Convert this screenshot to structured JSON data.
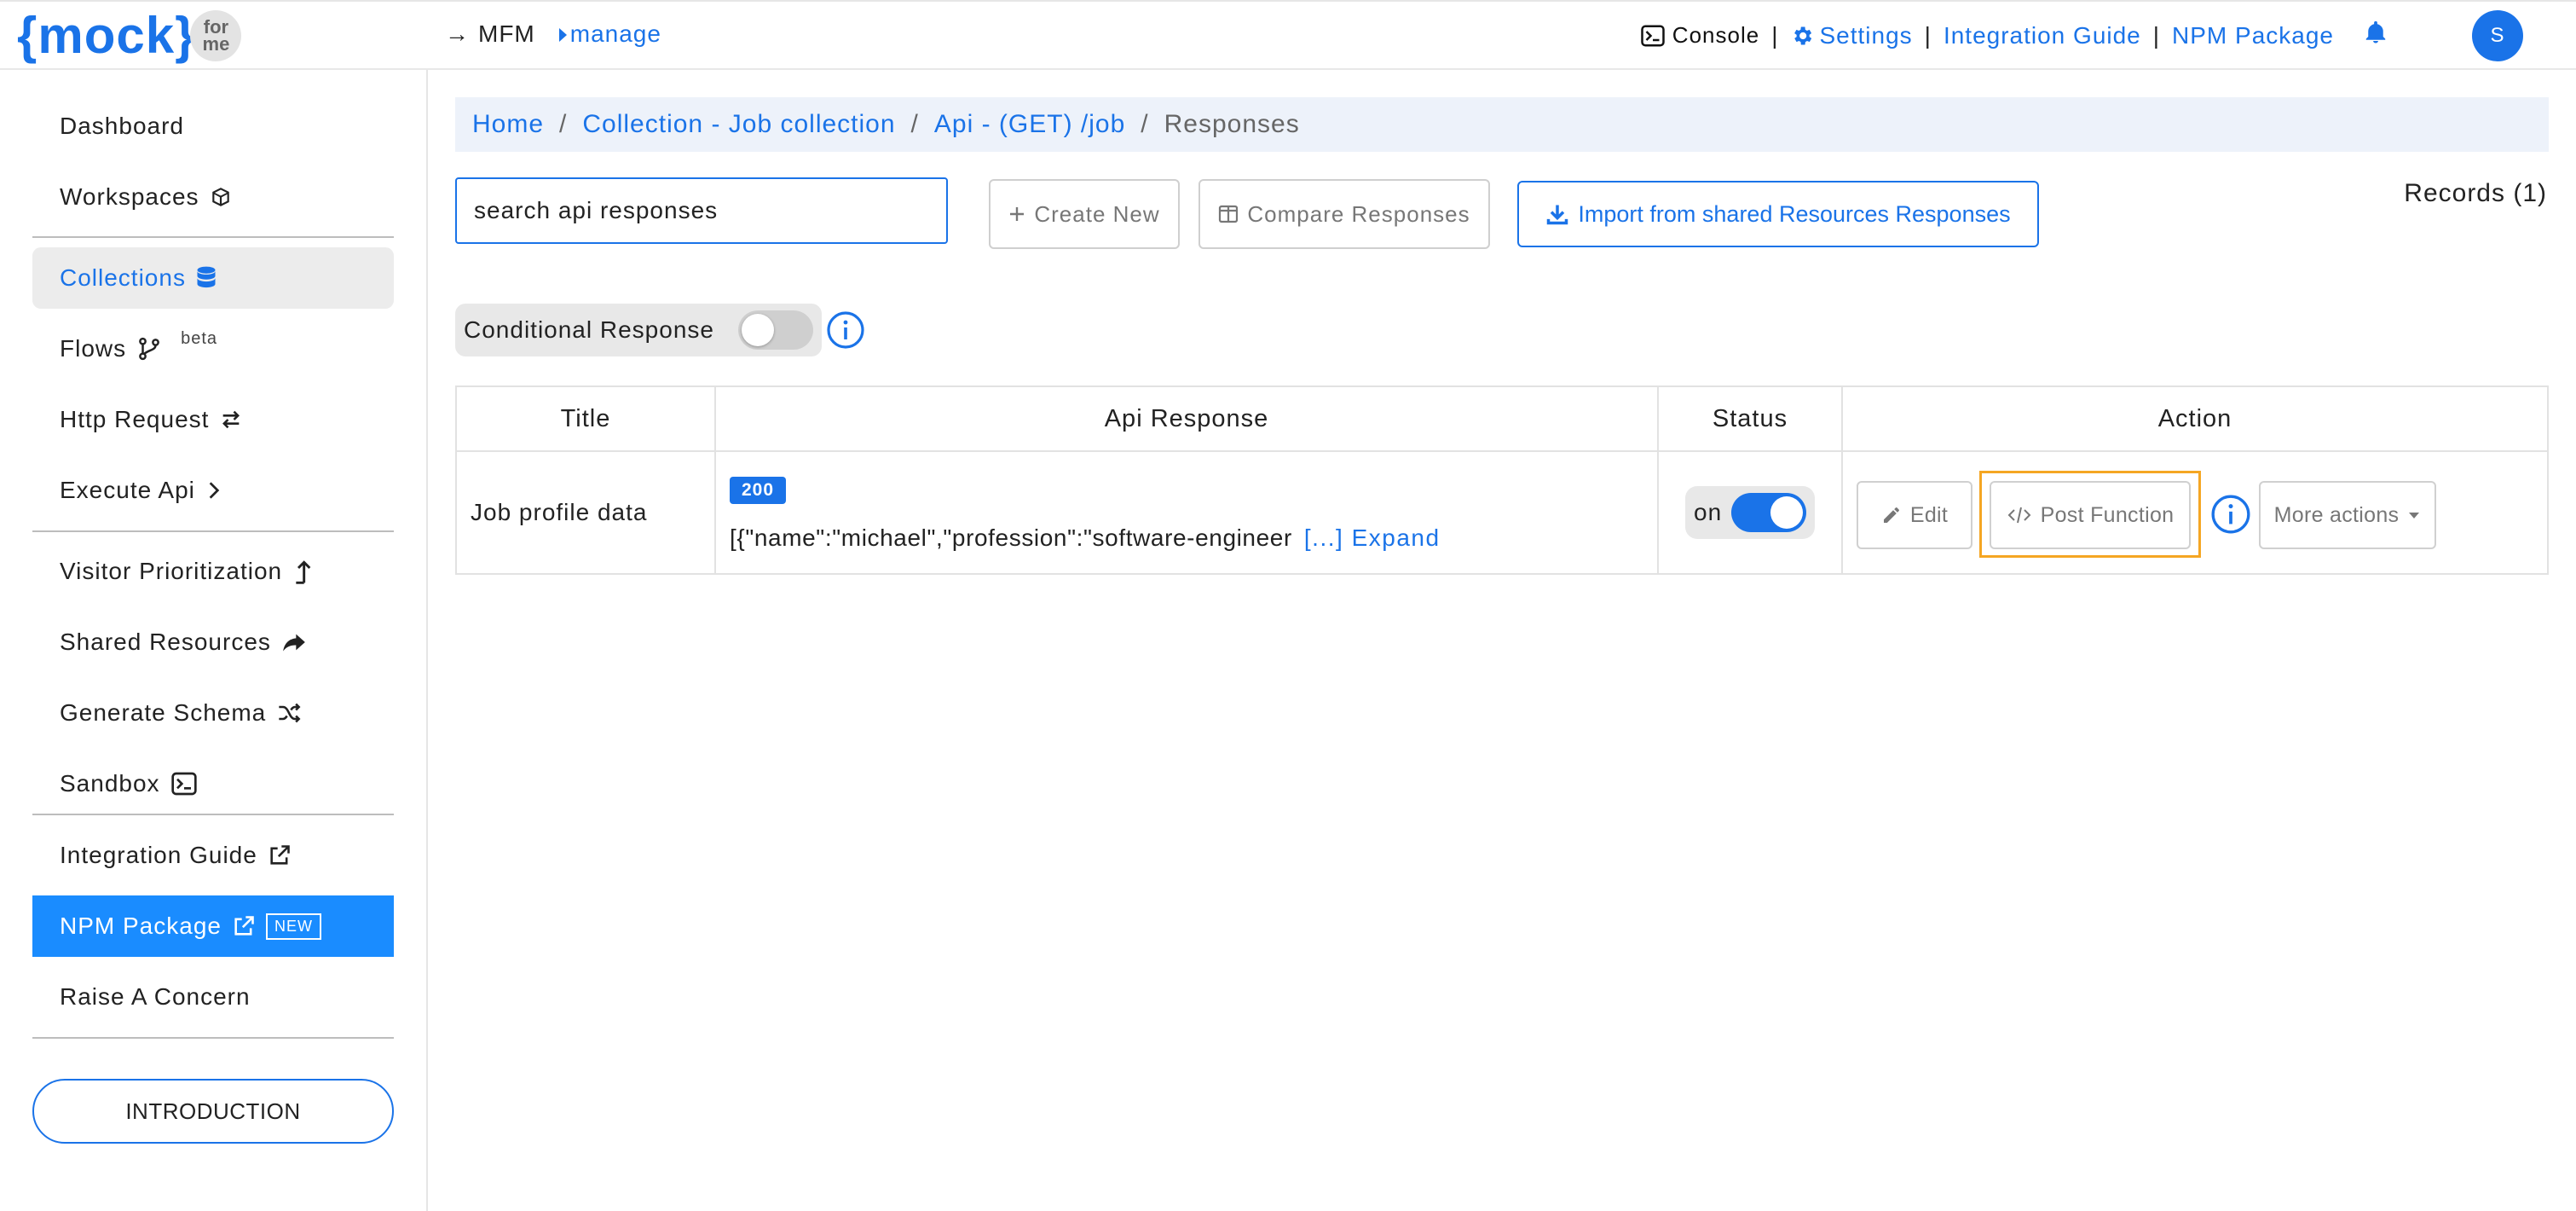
{
  "topbar": {
    "logo_text": "{mock}",
    "logo_badge_line1": "for",
    "logo_badge_line2": "me",
    "arrow": "→",
    "mfm": "MFM",
    "manage": "manage",
    "console": "Console",
    "separator": "|",
    "settings": "Settings",
    "integration_guide": "Integration Guide",
    "npm_package": "NPM Package",
    "avatar_initial": "S"
  },
  "sidebar": {
    "items": [
      {
        "label": "Dashboard"
      },
      {
        "label": "Workspaces"
      },
      {
        "label": "Collections"
      },
      {
        "label": "Flows",
        "badge": "beta"
      },
      {
        "label": "Http Request"
      },
      {
        "label": "Execute Api"
      },
      {
        "label": "Visitor Prioritization"
      },
      {
        "label": "Shared Resources"
      },
      {
        "label": "Generate Schema"
      },
      {
        "label": "Sandbox"
      },
      {
        "label": "Integration Guide"
      },
      {
        "label": "NPM Package",
        "badge": "NEW"
      },
      {
        "label": "Raise A Concern"
      }
    ],
    "intro_button": "INTRODUCTION"
  },
  "breadcrumb": {
    "home": "Home",
    "collection": "Collection - Job collection",
    "api": "Api - (GET) /job",
    "current": "Responses",
    "separator": "/"
  },
  "toolbar": {
    "search_value": "search api responses",
    "create_new": "Create New",
    "compare": "Compare Responses",
    "import": "Import from shared Resources Responses",
    "records": "Records (1)"
  },
  "conditional": {
    "label": "Conditional Response",
    "enabled": false
  },
  "table": {
    "headers": [
      "Title",
      "Api Response",
      "Status",
      "Action"
    ],
    "rows": [
      {
        "title": "Job profile data",
        "status_code": "200",
        "response_preview": "[{\"name\":\"michael\",\"profession\":\"software-engineer",
        "expand": "[...] Expand",
        "status_label": "on",
        "status_on": true,
        "edit": "Edit",
        "post_function": "Post Function",
        "more_actions": "More actions"
      }
    ]
  },
  "colors": {
    "accent": "#1a73e8",
    "highlight": "#f5a623",
    "sidebar_active_bg": "#ececec",
    "npm_bg": "#1a8cff"
  }
}
